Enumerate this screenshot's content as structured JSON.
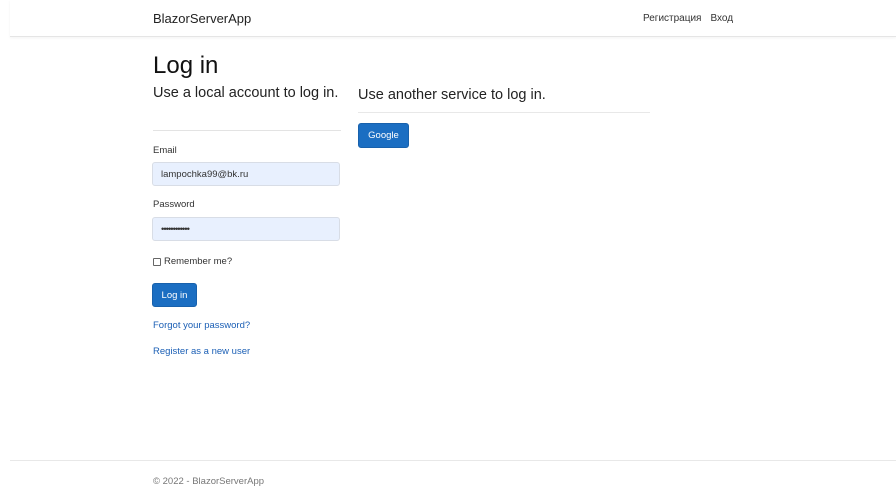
{
  "navbar": {
    "brand": "BlazorServerApp",
    "links": [
      "Регистрация",
      "Вход"
    ]
  },
  "page": {
    "title": "Log in",
    "left_heading": "Use a local account to log in.",
    "right_heading": "Use another service to log in."
  },
  "external": {
    "google_label": "Google"
  },
  "form": {
    "email_label": "Email",
    "email_value": "lampochka99@bk.ru",
    "password_label": "Password",
    "password_value": "••••••••••••",
    "remember_label": "Remember me?",
    "login_label": "Log in",
    "forgot_link": "Forgot your password?",
    "register_link": "Register as a new user"
  },
  "footer": {
    "text": "© 2022 - BlazorServerApp"
  },
  "colors": {
    "primary": "#1b6ec2",
    "link": "#1b5fb5",
    "input_bg": "#e8f0fe"
  }
}
